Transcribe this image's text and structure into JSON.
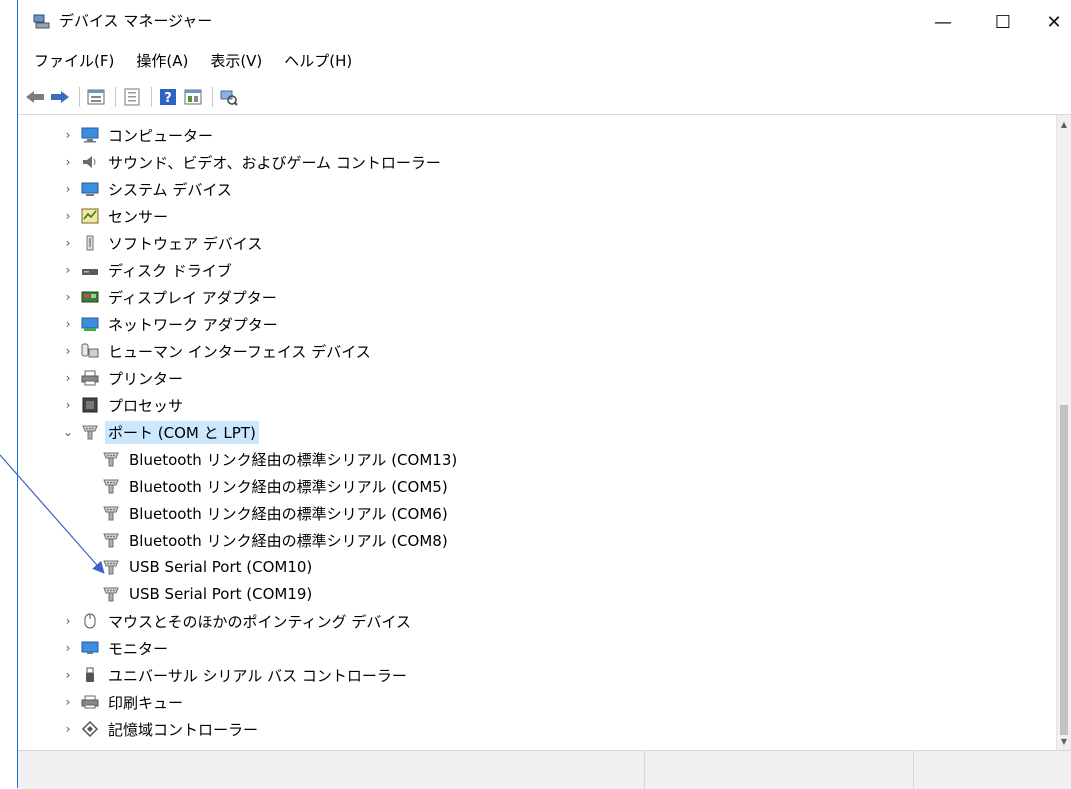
{
  "window": {
    "title": "デバイス マネージャー",
    "controls": {
      "minimize": "—",
      "maximize": "☐",
      "close": "✕"
    }
  },
  "menu": [
    {
      "label": "ファイル(F)"
    },
    {
      "label": "操作(A)"
    },
    {
      "label": "表示(V)"
    },
    {
      "label": "ヘルプ(H)"
    }
  ],
  "toolbar": {
    "icons": [
      "back-icon",
      "forward-icon",
      "properties-icon",
      "device-list-icon",
      "help-icon",
      "view-icon",
      "scan-hardware-icon"
    ]
  },
  "tree": {
    "items": [
      {
        "label": "コンピューター",
        "icon": "computer-icon",
        "chevron": "›"
      },
      {
        "label": "サウンド、ビデオ、およびゲーム コントローラー",
        "icon": "speaker-icon",
        "chevron": "›"
      },
      {
        "label": "システム デバイス",
        "icon": "system-device-icon",
        "chevron": "›"
      },
      {
        "label": "センサー",
        "icon": "sensor-icon",
        "chevron": "›"
      },
      {
        "label": "ソフトウェア デバイス",
        "icon": "software-device-icon",
        "chevron": "›"
      },
      {
        "label": "ディスク ドライブ",
        "icon": "disk-drive-icon",
        "chevron": "›"
      },
      {
        "label": "ディスプレイ アダプター",
        "icon": "display-adapter-icon",
        "chevron": "›"
      },
      {
        "label": "ネットワーク アダプター",
        "icon": "network-adapter-icon",
        "chevron": "›"
      },
      {
        "label": "ヒューマン インターフェイス デバイス",
        "icon": "hid-icon",
        "chevron": "›"
      },
      {
        "label": "プリンター",
        "icon": "printer-icon",
        "chevron": "›"
      },
      {
        "label": "プロセッサ",
        "icon": "processor-icon",
        "chevron": "›"
      },
      {
        "label": "ポート (COM と LPT)",
        "icon": "port-icon",
        "chevron": "⌄"
      },
      {
        "label": "Bluetooth リンク経由の標準シリアル (COM13)",
        "icon": "port-icon"
      },
      {
        "label": "Bluetooth リンク経由の標準シリアル (COM5)",
        "icon": "port-icon"
      },
      {
        "label": "Bluetooth リンク経由の標準シリアル (COM6)",
        "icon": "port-icon"
      },
      {
        "label": "Bluetooth リンク経由の標準シリアル (COM8)",
        "icon": "port-icon"
      },
      {
        "label": "USB Serial Port (COM10)",
        "icon": "port-icon"
      },
      {
        "label": "USB Serial Port (COM19)",
        "icon": "port-icon"
      },
      {
        "label": "マウスとそのほかのポインティング デバイス",
        "icon": "mouse-icon",
        "chevron": "›"
      },
      {
        "label": "モニター",
        "icon": "monitor-icon",
        "chevron": "›"
      },
      {
        "label": "ユニバーサル シリアル バス コントローラー",
        "icon": "usb-icon",
        "chevron": "›"
      },
      {
        "label": "印刷キュー",
        "icon": "print-queue-icon",
        "chevron": "›"
      },
      {
        "label": "記憶域コントローラー",
        "icon": "storage-controller-icon",
        "chevron": "›"
      }
    ]
  },
  "colors": {
    "selection": "#cce8ff",
    "accent": "#1e6fd0",
    "arrow": "#3a62c4"
  }
}
